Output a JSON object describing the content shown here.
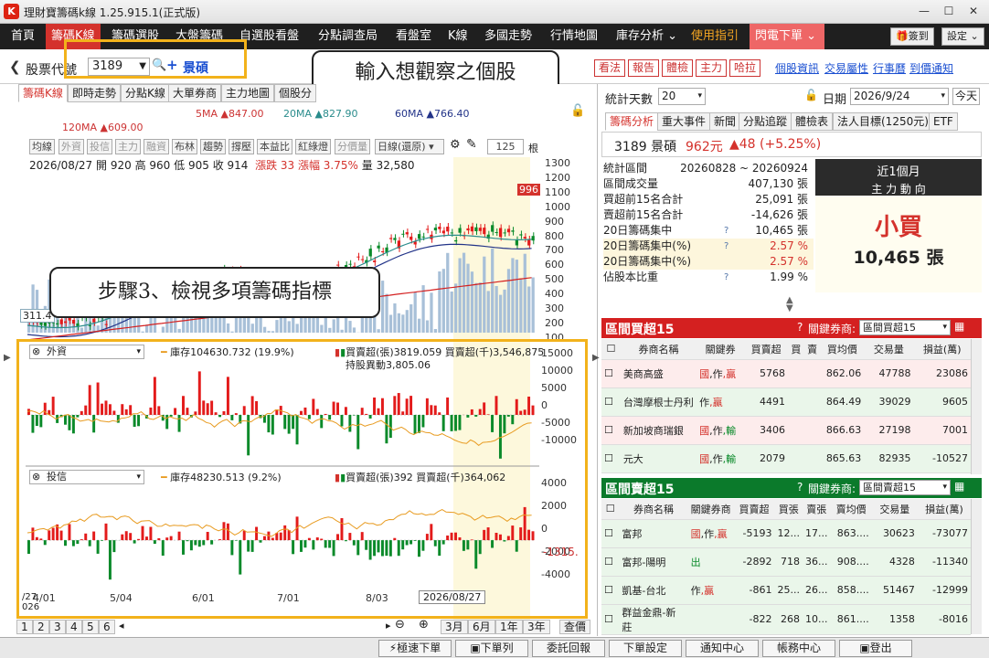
{
  "app": {
    "title": "理財寶籌碼k線 1.25.915.1(正式版)",
    "logo": "K"
  },
  "menu": {
    "items": [
      "首頁",
      "籌碼K線",
      "籌碼選股",
      "大盤籌碼",
      "自選股看盤",
      "分點調查局",
      "看盤室",
      "K線",
      "多國走勢",
      "行情地圖",
      "庫存分析 ⌄",
      "使用指引",
      "閃電下單 ⌄"
    ],
    "signin": "簽到",
    "settings": "設定"
  },
  "search": {
    "label": "股票代號",
    "code": "3189",
    "name": "景碩"
  },
  "right_buttons": [
    "看法",
    "報告",
    "體檢",
    "主力",
    "哈拉"
  ],
  "right_links": [
    "個股資訊",
    "交易屬性",
    "行事曆",
    "到價通知"
  ],
  "callouts": {
    "top": "輸入想觀察之個股",
    "left": "步驟3、檢視多項籌碼指標"
  },
  "left_tabs": [
    "籌碼K線",
    "即時走勢",
    "分點K線",
    "大單券商",
    "主力地圖",
    "個股分"
  ],
  "ma": {
    "ma5": "5MA ▲847.00",
    "ma20": "20MA ▲827.90",
    "ma60": "60MA ▲766.40",
    "ma120": "120MA ▲609.00"
  },
  "toolbar": {
    "items": [
      "均線",
      "外資",
      "投信",
      "主力",
      "融資",
      "布林",
      "趨勢",
      "撐壓",
      "本益比",
      "紅綠燈",
      "分價量"
    ],
    "mode": "日線(還原)",
    "count": "125",
    "unit": "根"
  },
  "ohlc": {
    "date": "2026/08/27",
    "open": "開 920",
    "high": "高 960",
    "low": "低 905",
    "close": "收 914",
    "change": "漲跌 33",
    "pct": "漲幅 3.75%",
    "vol": "量 32,580"
  },
  "price_axis": [
    "1300",
    "1200",
    "1100",
    "1000",
    "900",
    "800",
    "700",
    "600",
    "500",
    "400",
    "300",
    "200",
    "100"
  ],
  "last_price_tag": "996",
  "left_price_tag": "311.4",
  "panel1": {
    "select": "外資",
    "inv": "庫存104630.732 (19.9%)",
    "bs": "買賣超(張)3819.059 買賣超(千)3,546,875",
    "chg": "持股異動3,805.06",
    "axis": [
      "15000",
      "10000",
      "5000",
      "0",
      "-5000",
      "-10000"
    ]
  },
  "panel2": {
    "select": "投信",
    "inv": "庫存48230.513 (9.2%)",
    "bs": "買賣超(張)392 買賣超(千)364,062",
    "axis": [
      "4000",
      "2000",
      "0",
      "-2000",
      "-4000"
    ],
    "tag": "-1315."
  },
  "date_axis": [
    "/27\n026",
    "4/01",
    "5/04",
    "6/01",
    "7/01",
    "8/03"
  ],
  "date_tag": "2026/08/27",
  "pages": [
    "1",
    "2",
    "3",
    "4",
    "5",
    "6"
  ],
  "periods": [
    "3月",
    "6月",
    "1年",
    "3年",
    "查價"
  ],
  "stats": {
    "label": "統計天數",
    "days": "20",
    "date_label": "日期",
    "date": "2026/9/24",
    "today": "今天"
  },
  "rtabs": [
    "籌碼分析",
    "重大事件",
    "新聞",
    "分點追蹤",
    "體檢表",
    "法人目標(1250元)",
    "ETF"
  ],
  "quote": {
    "code": "3189 景碩",
    "price": "962元",
    "chg": "▲48 (+5.25%)"
  },
  "statrows": [
    {
      "k": "統計區間",
      "v": "20260828 ~ 20260924"
    },
    {
      "k": "區間成交量",
      "v": "407,130 張"
    },
    {
      "k": "買超前15名合計",
      "v": "25,091 張"
    },
    {
      "k": "賣超前15名合計",
      "v": "-14,626 張"
    },
    {
      "k": "20日籌碼集中",
      "q": "?",
      "v": "10,465 張"
    },
    {
      "k": "20日籌碼集中(%)",
      "q": "?",
      "v": "2.57 %"
    },
    {
      "k": "20日籌碼集中(%)",
      "v": "2.57 %"
    },
    {
      "k": "佔股本比重",
      "q": "?",
      "v": "1.99 %"
    }
  ],
  "summary": {
    "title": "近1個月",
    "sub": "主 力 動 向",
    "big": "小買",
    "amt": "10,465 張"
  },
  "buy": {
    "title": "區間買超15",
    "broker_label": "關鍵券商:",
    "broker": "區間買超15",
    "cols": [
      "券商名稱",
      "關鍵券",
      "買賣超",
      "買",
      "賣",
      "買均價",
      "交易量",
      "損益(萬)"
    ],
    "rows": [
      [
        "美商高盛",
        "國,作,贏",
        "5768",
        "",
        "",
        "862.06",
        "47788",
        "23086"
      ],
      [
        "台灣摩根士丹利",
        "作,贏",
        "4491",
        "",
        "",
        "864.49",
        "39029",
        "9605"
      ],
      [
        "新加坡商瑞銀",
        "國,作,輸",
        "3406",
        "",
        "",
        "866.63",
        "27198",
        "7001"
      ],
      [
        "元大",
        "國,作,輸",
        "2079",
        "",
        "",
        "865.63",
        "82935",
        "-10527"
      ]
    ]
  },
  "sell": {
    "title": "區間賣超15",
    "broker_label": "關鍵券商:",
    "broker": "區間賣超15",
    "cols": [
      "券商名稱",
      "關鍵券商",
      "買賣超",
      "買張",
      "賣張",
      "賣均價",
      "交易量",
      "損益(萬)"
    ],
    "rows": [
      [
        "富邦",
        "國,作,贏",
        "-5193",
        "12...",
        "17...",
        "863....",
        "30623",
        "-73077"
      ],
      [
        "富邦-陽明",
        "出",
        "-2892",
        "718",
        "36...",
        "908....",
        "4328",
        "-11340"
      ],
      [
        "凱基-台北",
        "作,贏",
        "-861",
        "25...",
        "26...",
        "858....",
        "51467",
        "-12999"
      ],
      [
        "群益金鼎-新莊",
        "",
        "-822",
        "268",
        "10...",
        "861....",
        "1358",
        "-8016"
      ]
    ]
  },
  "bottom": [
    "極速下單",
    "下單列",
    "委託回報",
    "下單設定",
    "通知中心",
    "帳務中心",
    "登出"
  ],
  "colors": {
    "accent": "#d4322c",
    "menu": "#1f1f1f",
    "highlight": "#f2b21b",
    "buy": "#e31b1b",
    "sell": "#0b7a2b"
  }
}
